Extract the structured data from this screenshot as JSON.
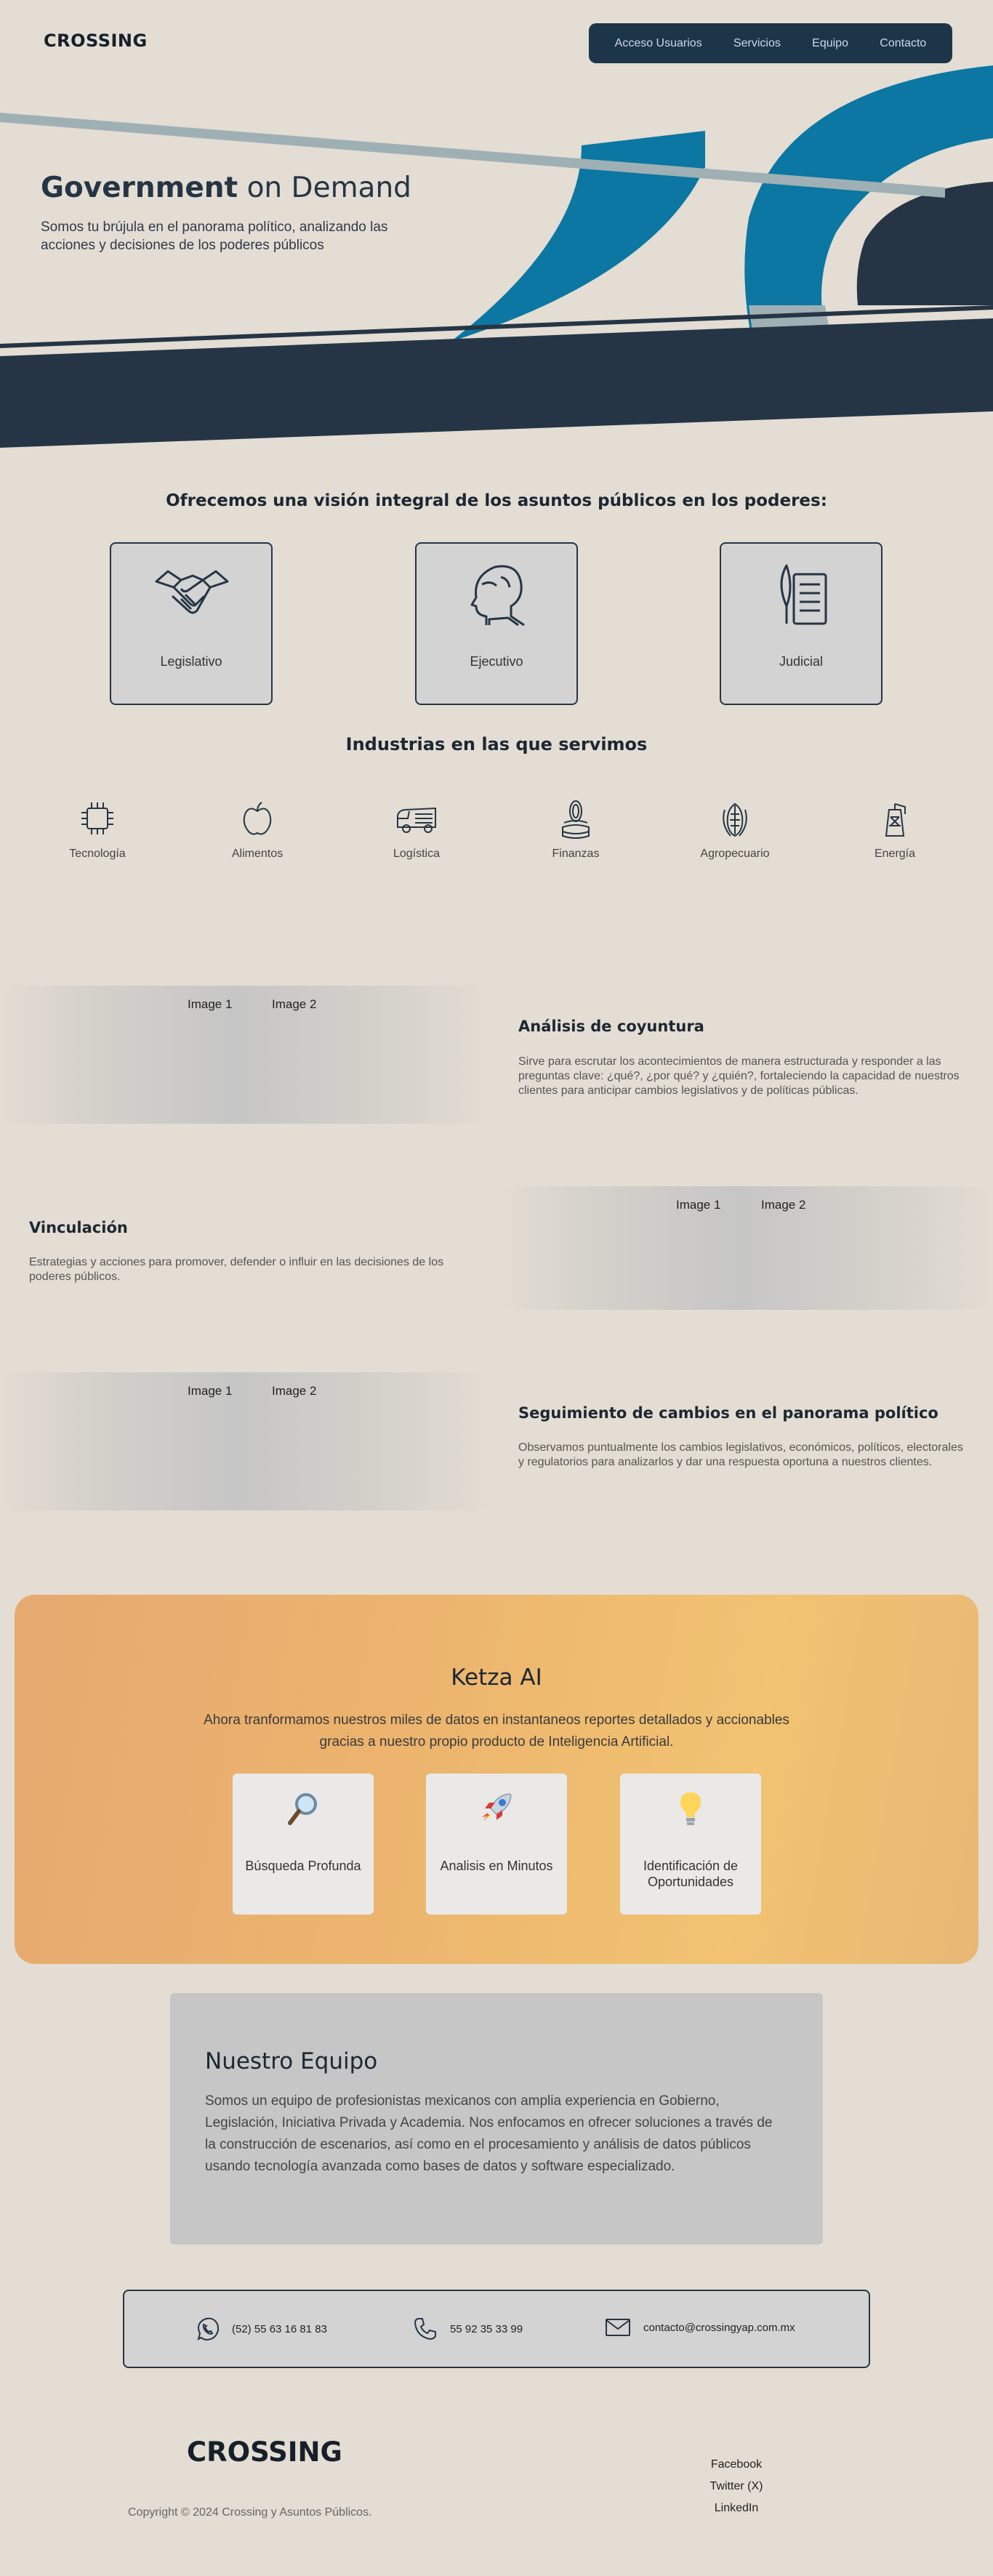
{
  "header": {
    "logo": "CROSSING",
    "nav": [
      "Acceso Usuarios",
      "Servicios",
      "Equipo",
      "Contacto"
    ]
  },
  "hero": {
    "title_bold": "Government",
    "title_light": " on Demand",
    "subtitle": "Somos tu brújula en el panorama político, analizando las acciones y decisiones de los poderes públicos"
  },
  "powers": {
    "title": "Ofrecemos una visión integral de los asuntos públicos en los poderes:",
    "items": [
      "Legislativo",
      "Ejecutivo",
      "Judicial"
    ]
  },
  "industries": {
    "title": "Industrias en las que servimos",
    "items": [
      "Tecnología",
      "Alimentos",
      "Logística",
      "Finanzas",
      "Agropecuario",
      "Energía"
    ]
  },
  "image_tags": [
    "Image 1",
    "Image 2"
  ],
  "features": [
    {
      "title": "Análisis de coyuntura",
      "text": "Sirve para escrutar los acontecimientos de manera estructurada y responder a las preguntas clave: ¿qué?, ¿por qué? y ¿quién?, fortaleciendo la capacidad de nuestros clientes para anticipar cambios legislativos y de políticas públicas."
    },
    {
      "title": "Vinculación",
      "text": "Estrategias y acciones para promover, defender o influir en las decisiones de los poderes públicos."
    },
    {
      "title": "Seguimiento de cambios en el panorama político",
      "text": "Observamos puntualmente los cambios legislativos, económicos, políticos, electorales y regulatorios para analizarlos y dar una respuesta oportuna a nuestros clientes."
    }
  ],
  "ketza": {
    "title": "Ketza AI",
    "subtitle": "Ahora tranformamos nuestros miles de datos en instantaneos reportes detallados y accionables gracias a nuestro propio producto de Inteligencia Artificial.",
    "cards": [
      {
        "icon": "magnifying-glass-icon",
        "emoji": "🔍",
        "label": "Búsqueda Profunda"
      },
      {
        "icon": "rocket-icon",
        "emoji": "🚀",
        "label": "Analisis en Minutos"
      },
      {
        "icon": "lightbulb-icon",
        "emoji": "💡",
        "label": "Identificación de Oportunidades"
      }
    ]
  },
  "team": {
    "title": "Nuestro Equipo",
    "text": "Somos un equipo de profesionistas mexicanos con amplia experiencia en Gobierno, Legislación, Iniciativa Privada y Academia. Nos enfocamos en ofrecer soluciones a través de la construcción de escenarios, así como en el procesamiento y análisis de datos públicos usando tecnología avanzada como bases de datos y software especializado."
  },
  "contact": {
    "whatsapp": "(52) 55 63 16 81 83",
    "phone": "55 92 35 33 99",
    "email": "contacto@crossingyap.com.mx"
  },
  "footer": {
    "logo": "CROSSING",
    "copyright": "Copyright © 2024 Crossing y Asuntos Públicos.",
    "links": [
      "Facebook",
      "Twitter (X)",
      "LinkedIn"
    ]
  },
  "colors": {
    "background": "#e3ddd3",
    "navy": "#263545",
    "blue": "#0b77a2",
    "slate": "#9fb0b5",
    "ketza_orange": "#ecb46e"
  }
}
